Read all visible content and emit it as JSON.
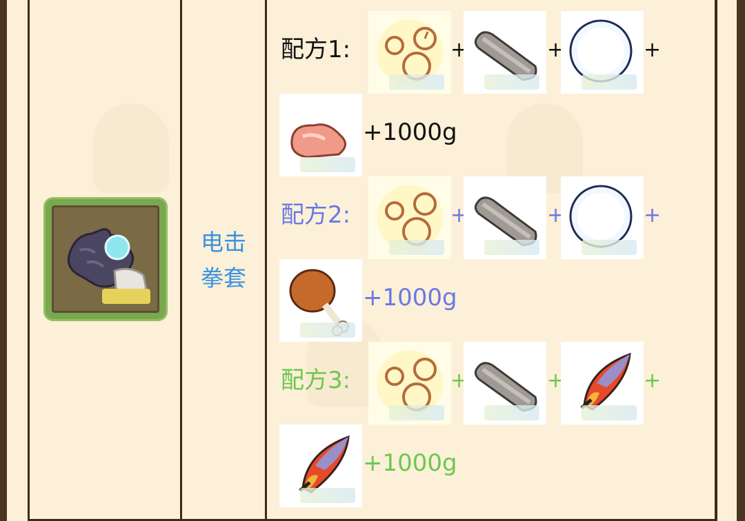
{
  "item": {
    "name_line1": "电击",
    "name_line2": "拳套",
    "icon": "electric-glove-icon"
  },
  "recipes": [
    {
      "label": "配方1:",
      "color": "#111111",
      "plus": "+",
      "cost": "+1000g",
      "ingredients": [
        "gear-cluster-icon",
        "stone-slab-icon",
        "snowball-icon",
        "raw-meat-icon"
      ]
    },
    {
      "label": "配方2:",
      "color": "#6a78e6",
      "plus": "+",
      "cost": "+1000g",
      "ingredients": [
        "gear-cluster-icon",
        "stone-slab-icon",
        "snowball-icon",
        "drumstick-icon"
      ]
    },
    {
      "label": "配方3:",
      "color": "#6cc84c",
      "plus": "+",
      "cost": "+1000g",
      "ingredients": [
        "gear-cluster-icon",
        "stone-slab-icon",
        "feather-icon",
        "feather-icon"
      ]
    }
  ]
}
